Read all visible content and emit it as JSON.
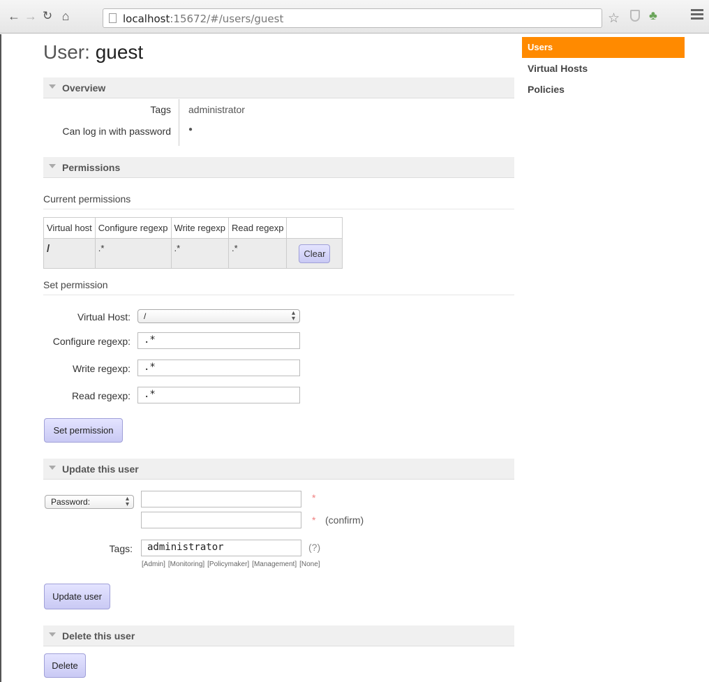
{
  "browser": {
    "url_host": "localhost",
    "url_rest": ":15672/#/users/guest",
    "star_icon": "star-outline-icon",
    "menu_icon": "hamburger-icon"
  },
  "title": {
    "prefix": "User:",
    "name": "guest"
  },
  "overview": {
    "label": "Overview",
    "rows": [
      {
        "key": "Tags",
        "value": "administrator"
      },
      {
        "key": "Can log in with password",
        "value": "●"
      }
    ]
  },
  "permissions": {
    "label": "Permissions",
    "current_heading": "Current permissions",
    "columns": [
      "Virtual host",
      "Configure regexp",
      "Write regexp",
      "Read regexp"
    ],
    "rows": [
      {
        "vhost": "/",
        "configure": ".*",
        "write": ".*",
        "read": ".*",
        "action": "Clear"
      }
    ],
    "set_heading": "Set permission",
    "form": {
      "vhost_label": "Virtual Host:",
      "vhost_value": "/",
      "configure_label": "Configure regexp:",
      "configure_value": ".*",
      "write_label": "Write regexp:",
      "write_value": ".*",
      "read_label": "Read regexp:",
      "read_value": ".*",
      "submit": "Set permission"
    }
  },
  "update": {
    "label": "Update this user",
    "password_mode": "Password:",
    "required_mark": "*",
    "confirm_hint": "(confirm)",
    "tags_label": "Tags:",
    "tags_value": "administrator",
    "tags_help": "(?)",
    "tag_options": [
      "[Admin]",
      "[Monitoring]",
      "[Policymaker]",
      "[Management]",
      "[None]"
    ],
    "submit": "Update user"
  },
  "delete": {
    "label": "Delete this user",
    "submit": "Delete"
  },
  "sidebar": {
    "items": [
      {
        "label": "Users",
        "active": true
      },
      {
        "label": "Virtual Hosts",
        "active": false
      },
      {
        "label": "Policies",
        "active": false
      }
    ],
    "accent": "#ff8a00"
  }
}
